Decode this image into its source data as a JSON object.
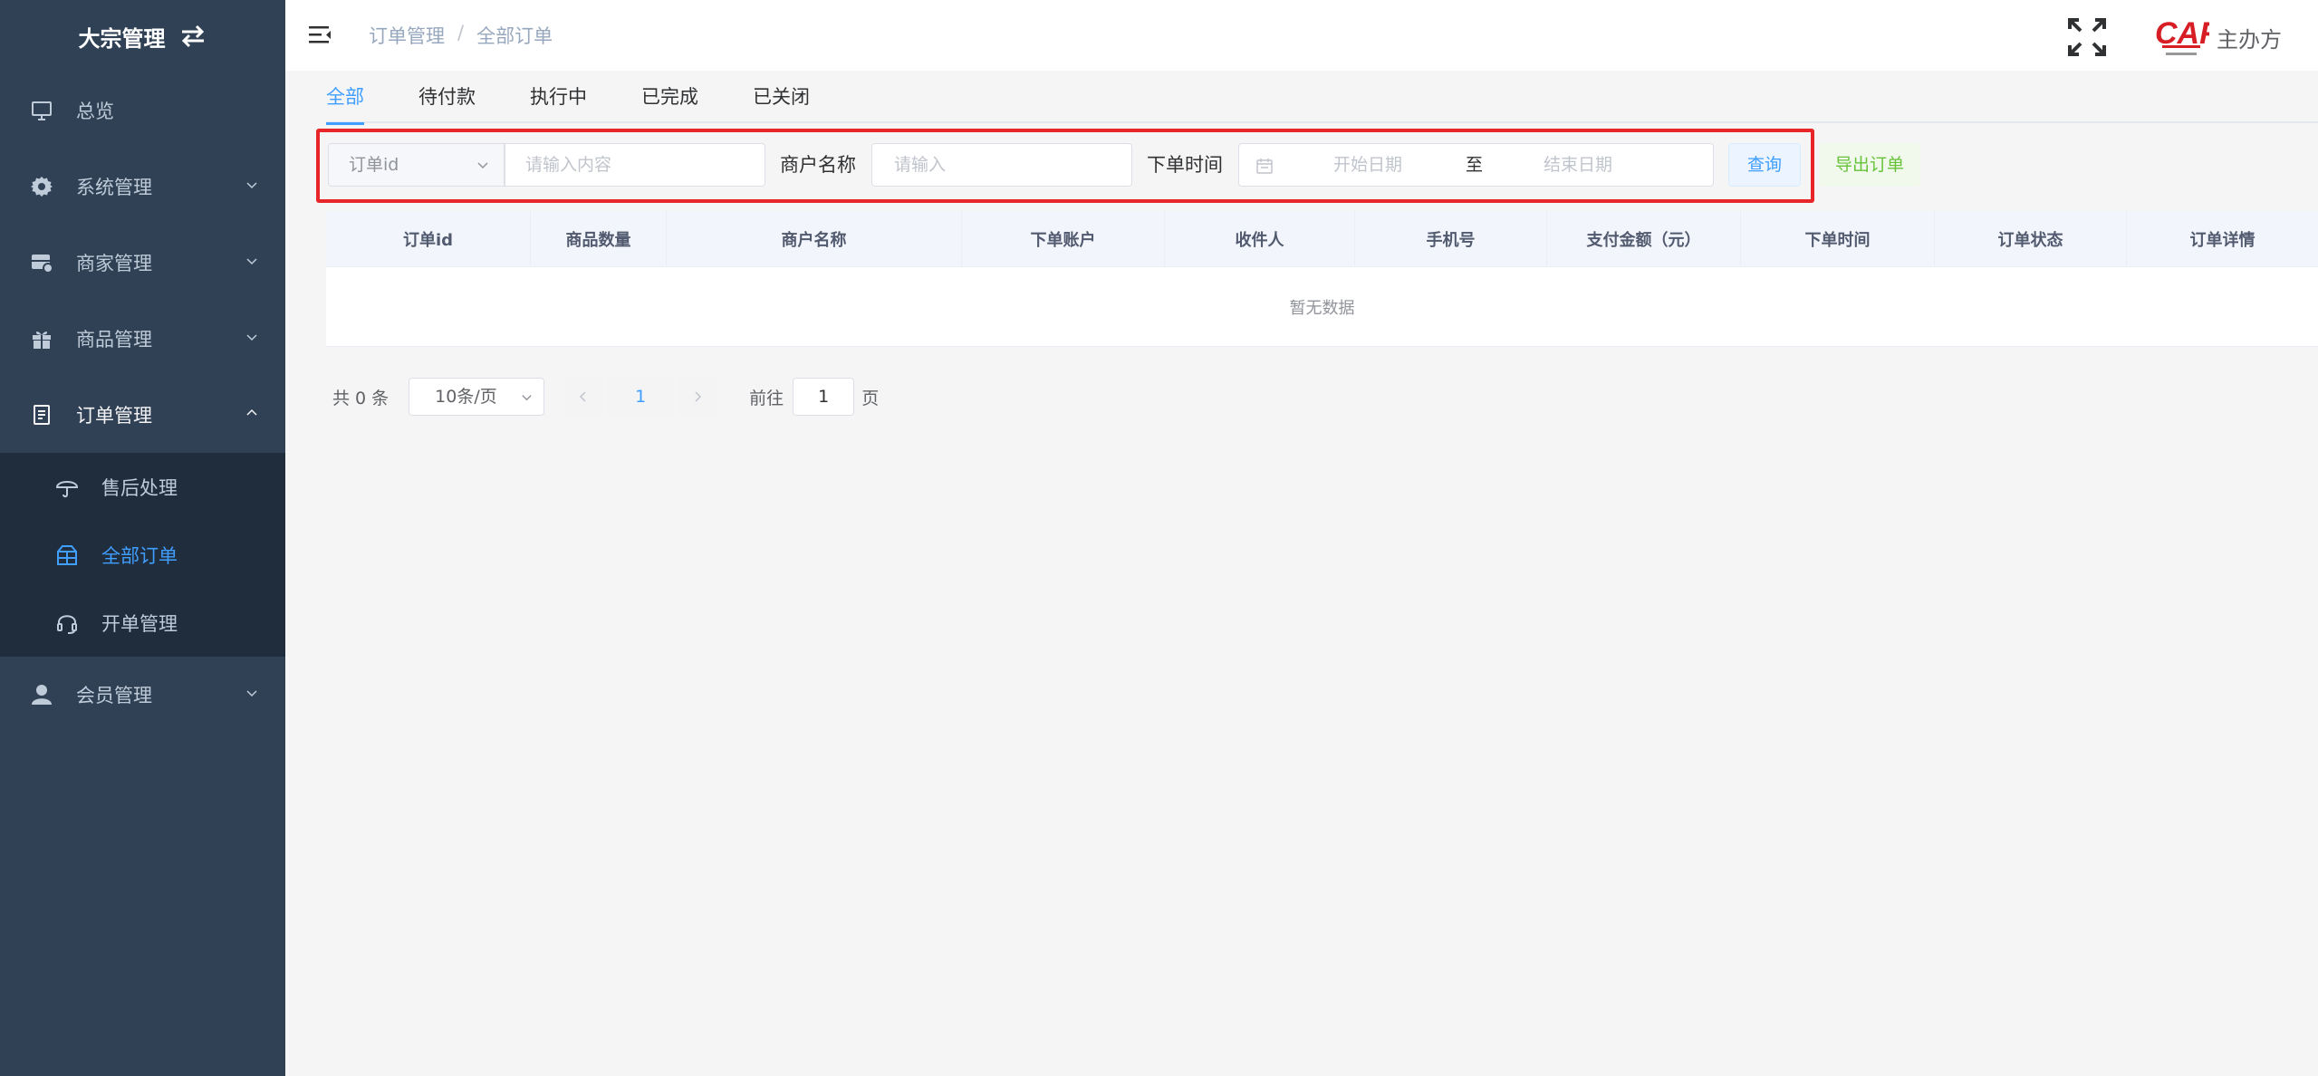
{
  "sidebar": {
    "brand": "大宗管理",
    "items": [
      {
        "label": "总览",
        "icon": "monitor-icon"
      },
      {
        "label": "系统管理",
        "icon": "gear-icon"
      },
      {
        "label": "商家管理",
        "icon": "store-icon"
      },
      {
        "label": "商品管理",
        "icon": "gift-icon"
      },
      {
        "label": "订单管理",
        "icon": "document-icon"
      },
      {
        "label": "会员管理",
        "icon": "user-icon"
      }
    ],
    "sub_items": [
      {
        "label": "售后处理",
        "icon": "umbrella-icon"
      },
      {
        "label": "全部订单",
        "icon": "box-icon",
        "active": true
      },
      {
        "label": "开单管理",
        "icon": "headset-icon"
      }
    ]
  },
  "header": {
    "breadcrumb": [
      "订单管理",
      "全部订单"
    ],
    "breadcrumb_sep": "/",
    "user_name": "主办方",
    "logo_text": "CAF"
  },
  "tabs": [
    "全部",
    "待付款",
    "执行中",
    "已完成",
    "已关闭"
  ],
  "filter": {
    "select_value": "订单id",
    "content_placeholder": "请输入内容",
    "merchant_label": "商户名称",
    "merchant_placeholder": "请输入",
    "time_label": "下单时间",
    "start_placeholder": "开始日期",
    "range_sep": "至",
    "end_placeholder": "结束日期",
    "query_button": "查询",
    "export_button": "导出订单"
  },
  "table": {
    "columns": [
      "订单id",
      "商品数量",
      "商户名称",
      "下单账户",
      "收件人",
      "手机号",
      "支付金额（元）",
      "下单时间",
      "订单状态",
      "订单详情"
    ],
    "empty_text": "暂无数据"
  },
  "pagination": {
    "total": "共 0 条",
    "page_size": "10条/页",
    "current_page": "1",
    "goto_label": "前往",
    "goto_value": "1",
    "page_unit": "页"
  },
  "colors": {
    "sidebar_bg": "#304156",
    "submenu_bg": "#1f2d3d",
    "accent": "#409eff",
    "highlight_border": "#e8262a",
    "export_green": "#67c23a"
  }
}
